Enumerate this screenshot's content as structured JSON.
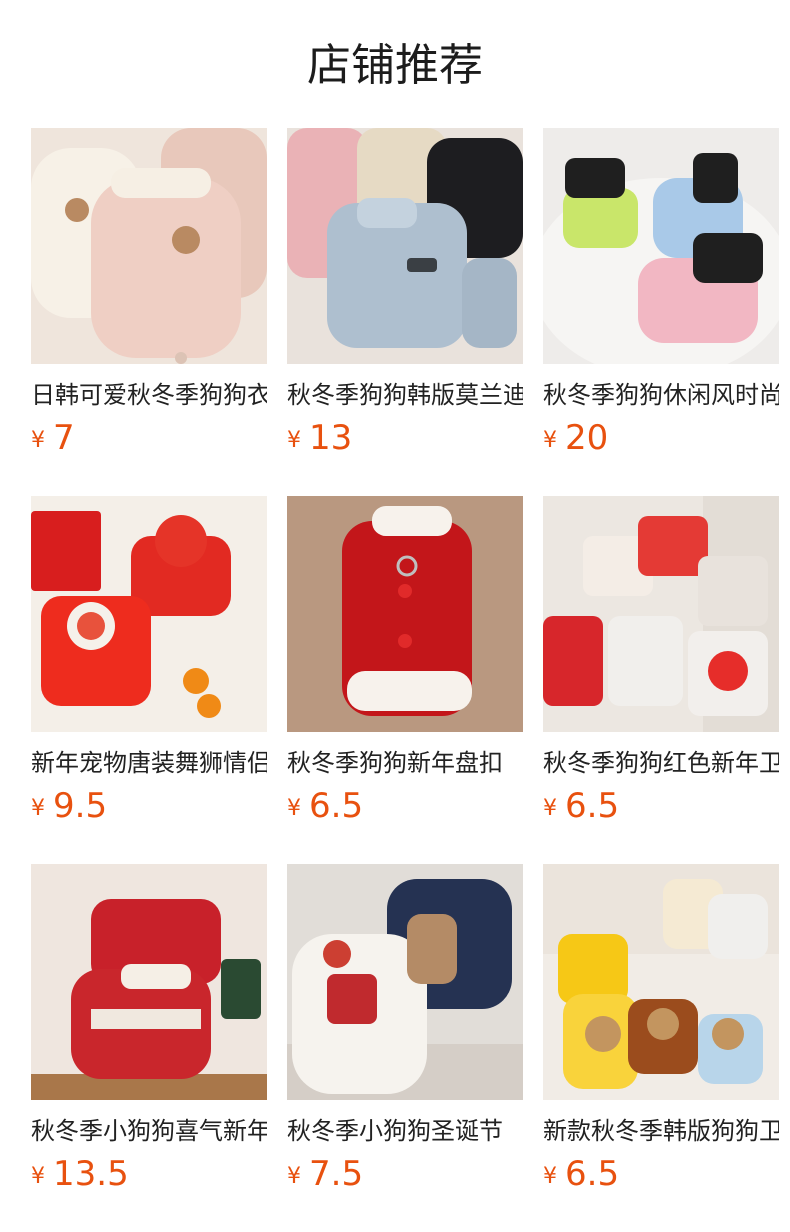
{
  "page": {
    "title": "店铺推荐"
  },
  "currency_symbol": "¥",
  "products": [
    {
      "name": "日韩可爱秋冬季狗狗衣服",
      "price": "7",
      "image": "pink-fleece-bear-vest"
    },
    {
      "name": "秋冬季狗狗韩版莫兰迪",
      "price": "13",
      "image": "blue-puffer-vest"
    },
    {
      "name": "秋冬季狗狗休闲风时尚",
      "price": "20",
      "image": "colorful-puffer-jackets"
    },
    {
      "name": "新年宠物唐装舞狮情侣",
      "price": "9.5",
      "image": "red-lion-dance-outfits"
    },
    {
      "name": "秋冬季狗狗新年盘扣",
      "price": "6.5",
      "image": "red-tang-suit-vest"
    },
    {
      "name": "秋冬季狗狗红色新年卫衣",
      "price": "6.5",
      "image": "red-checkered-sweaters"
    },
    {
      "name": "秋冬季小狗狗喜气新年",
      "price": "13.5",
      "image": "red-christmas-knit-sweater"
    },
    {
      "name": "秋冬季小狗狗圣诞节",
      "price": "7.5",
      "image": "plaid-sherpa-coats"
    },
    {
      "name": "新款秋冬季韩版狗狗卫衣",
      "price": "6.5",
      "image": "bear-hoodies"
    }
  ],
  "colors": {
    "price": "#e8510f",
    "title": "#1c1c1c"
  }
}
